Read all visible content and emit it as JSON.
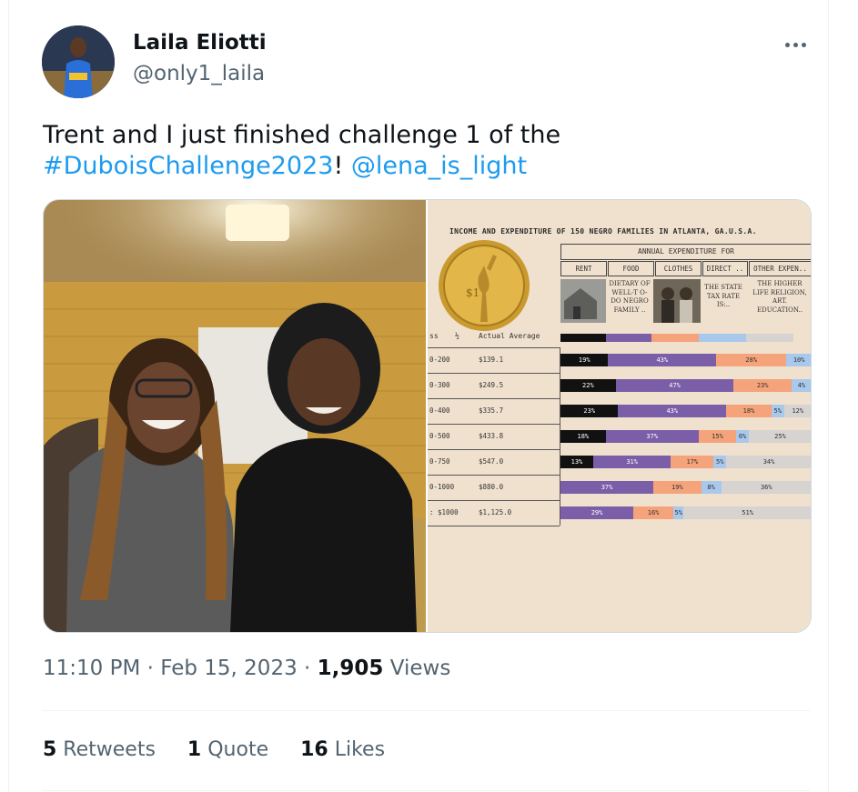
{
  "author": {
    "name": "Laila Eliotti",
    "handle": "@only1_laila"
  },
  "tweet": {
    "text_before": "Trent and I just finished challenge 1 of the ",
    "hashtag": "#DuboisChallenge2023",
    "text_mid": "! ",
    "mention": "@lena_is_light"
  },
  "media_chart": {
    "title": "INCOME AND EXPENDITURE OF 150 NEGRO FAMILIES IN ATLANTA, GA.U.S.A.",
    "annual_header": "ANNUAL EXPENDITURE FOR",
    "categories": [
      "RENT",
      "FOOD",
      "CLOTHES",
      "DIRECT ..",
      "OTHER EXPEN.."
    ],
    "descriptions": [
      "DIETARY OF WELL-T O-DO NEGRO FAMILY ..",
      "THE STATE TAX RATE IS:..",
      "THE HIGHER LIFE RELIGION, ART. EDUCATION.."
    ],
    "col_class": "ss",
    "col_half": "½",
    "col_avg": "Actual Average",
    "colors": {
      "rent": "#111111",
      "food": "#7a5ea8",
      "clothes": "#f5a37a",
      "direct": "#a8c8ec",
      "other": "#d6d3d0"
    },
    "rows": [
      {
        "cls": "0-200",
        "avg": "$139.1",
        "segs": [
          [
            "rent",
            "19%",
            19
          ],
          [
            "food",
            "43%",
            43
          ],
          [
            "clothes",
            "28%",
            28
          ],
          [
            "direct",
            "10%",
            10
          ]
        ]
      },
      {
        "cls": "0-300",
        "avg": "$249.5",
        "segs": [
          [
            "rent",
            "22%",
            22
          ],
          [
            "food",
            "47%",
            47
          ],
          [
            "clothes",
            "23%",
            23
          ],
          [
            "direct",
            "4%",
            8
          ]
        ]
      },
      {
        "cls": "0-400",
        "avg": "$335.7",
        "segs": [
          [
            "rent",
            "23%",
            23
          ],
          [
            "food",
            "43%",
            43
          ],
          [
            "clothes",
            "18%",
            18
          ],
          [
            "direct",
            "5%",
            5
          ],
          [
            "other",
            "12%",
            11
          ]
        ]
      },
      {
        "cls": "0-500",
        "avg": "$433.8",
        "segs": [
          [
            "rent",
            "18%",
            18
          ],
          [
            "food",
            "37%",
            37
          ],
          [
            "clothes",
            "15%",
            15
          ],
          [
            "direct",
            "6%",
            5
          ],
          [
            "other",
            "25%",
            25
          ]
        ]
      },
      {
        "cls": "0-750",
        "avg": "$547.0",
        "segs": [
          [
            "rent",
            "13%",
            13
          ],
          [
            "food",
            "31%",
            31
          ],
          [
            "clothes",
            "17%",
            17
          ],
          [
            "direct",
            "5%",
            5
          ],
          [
            "other",
            "34%",
            34
          ]
        ]
      },
      {
        "cls": "0-1000",
        "avg": "$880.0",
        "segs": [
          [
            "food",
            "37%",
            37
          ],
          [
            "clothes",
            "19%",
            19
          ],
          [
            "direct",
            "8%",
            8
          ],
          [
            "other",
            "36%",
            36
          ]
        ]
      },
      {
        "cls": ": $1000",
        "avg": "$1,125.0",
        "segs": [
          [
            "food",
            "29%",
            29
          ],
          [
            "clothes",
            "16%",
            16
          ],
          [
            "direct",
            "5%",
            4
          ],
          [
            "other",
            "51%",
            51
          ]
        ]
      }
    ]
  },
  "meta": {
    "time": "11:10 PM",
    "dot1": " · ",
    "date": "Feb 15, 2023",
    "dot2": " · ",
    "views_count": "1,905",
    "views_label": " Views"
  },
  "stats": {
    "retweets_count": "5",
    "retweets_label": " Retweets",
    "quotes_count": "1",
    "quotes_label": " Quote",
    "likes_count": "16",
    "likes_label": " Likes"
  },
  "icons": {
    "more": "more-horizontal-icon"
  }
}
